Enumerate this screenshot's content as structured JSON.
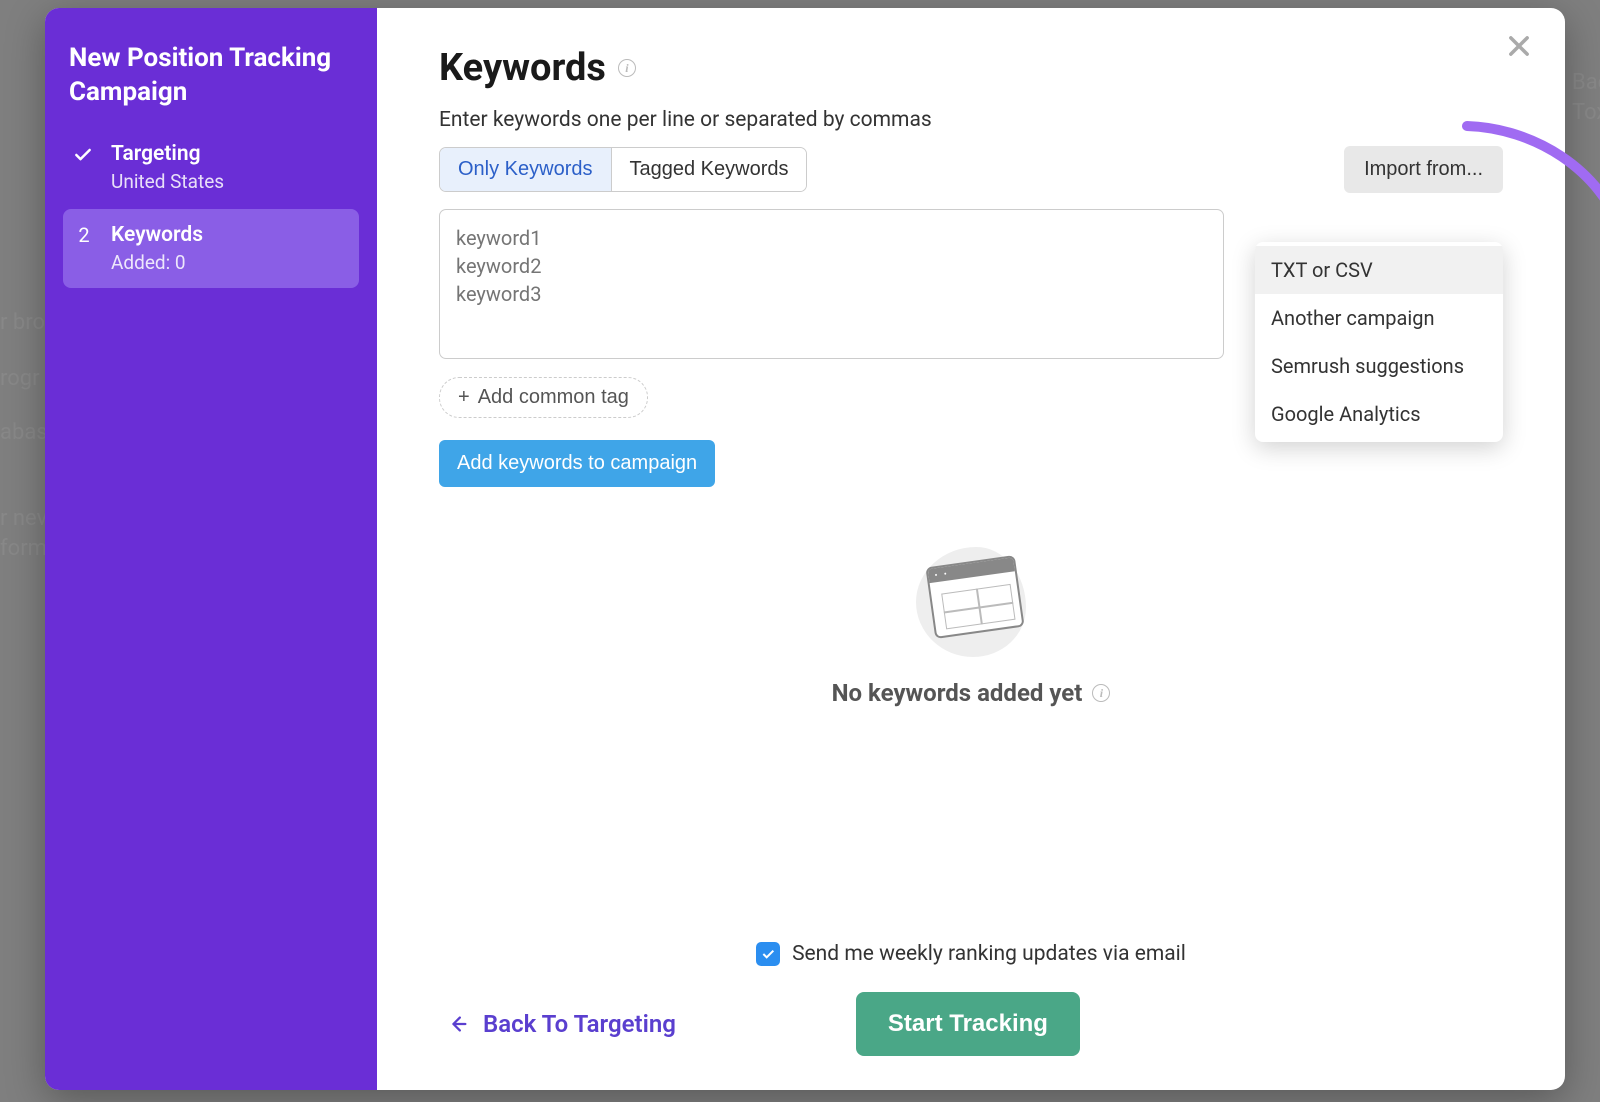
{
  "sidebar": {
    "heading": "New Position Tracking Campaign",
    "steps": [
      {
        "title": "Targeting",
        "sub": "United States",
        "completed": true
      },
      {
        "title": "Keywords",
        "sub": "Added: 0",
        "num": "2",
        "active": true
      }
    ]
  },
  "main": {
    "title": "Keywords",
    "subtitle": "Enter keywords one per line or separated by commas",
    "tabs": {
      "only": "Only Keywords",
      "tagged": "Tagged Keywords"
    },
    "import_button": "Import from...",
    "textarea_placeholder": "keyword1\nkeyword2\nkeyword3",
    "add_tag": "Add common tag",
    "add_keywords_btn": "Add keywords to campaign",
    "empty_state": "No keywords added yet",
    "weekly_checkbox": "Send me weekly ranking updates via email",
    "back_link": "Back To Targeting",
    "start_button": "Start Tracking"
  },
  "import_dropdown": [
    "TXT or CSV",
    "Another campaign",
    "Semrush suggestions",
    "Google Analytics"
  ],
  "colors": {
    "sidebar": "#6a2ed6",
    "accent_blue": "#3fa5e8",
    "accent_green": "#4aa787",
    "accent_purple": "#5a3fcf"
  }
}
